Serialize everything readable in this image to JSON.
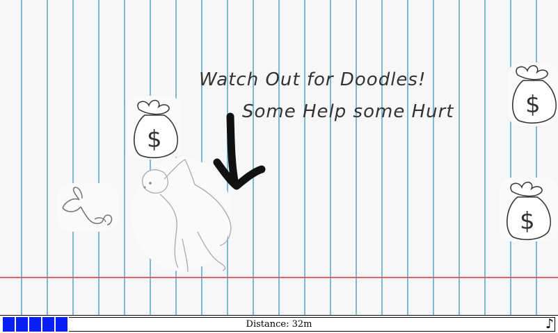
{
  "hints": {
    "line1": "Watch Out for Doodles!",
    "line2": "Some Help some Hurt"
  },
  "hud": {
    "distance_label": "Distance: ",
    "distance_value": "32m",
    "health_cells": 5,
    "music_icon": "♪"
  },
  "colors": {
    "paper_line": "#7fb7d3",
    "margin_line": "#e0606a",
    "health": "#0a1ff5"
  },
  "objects": [
    "money-bag",
    "money-bag",
    "money-bag",
    "bear-player",
    "mouse-doodle",
    "down-arrow"
  ]
}
